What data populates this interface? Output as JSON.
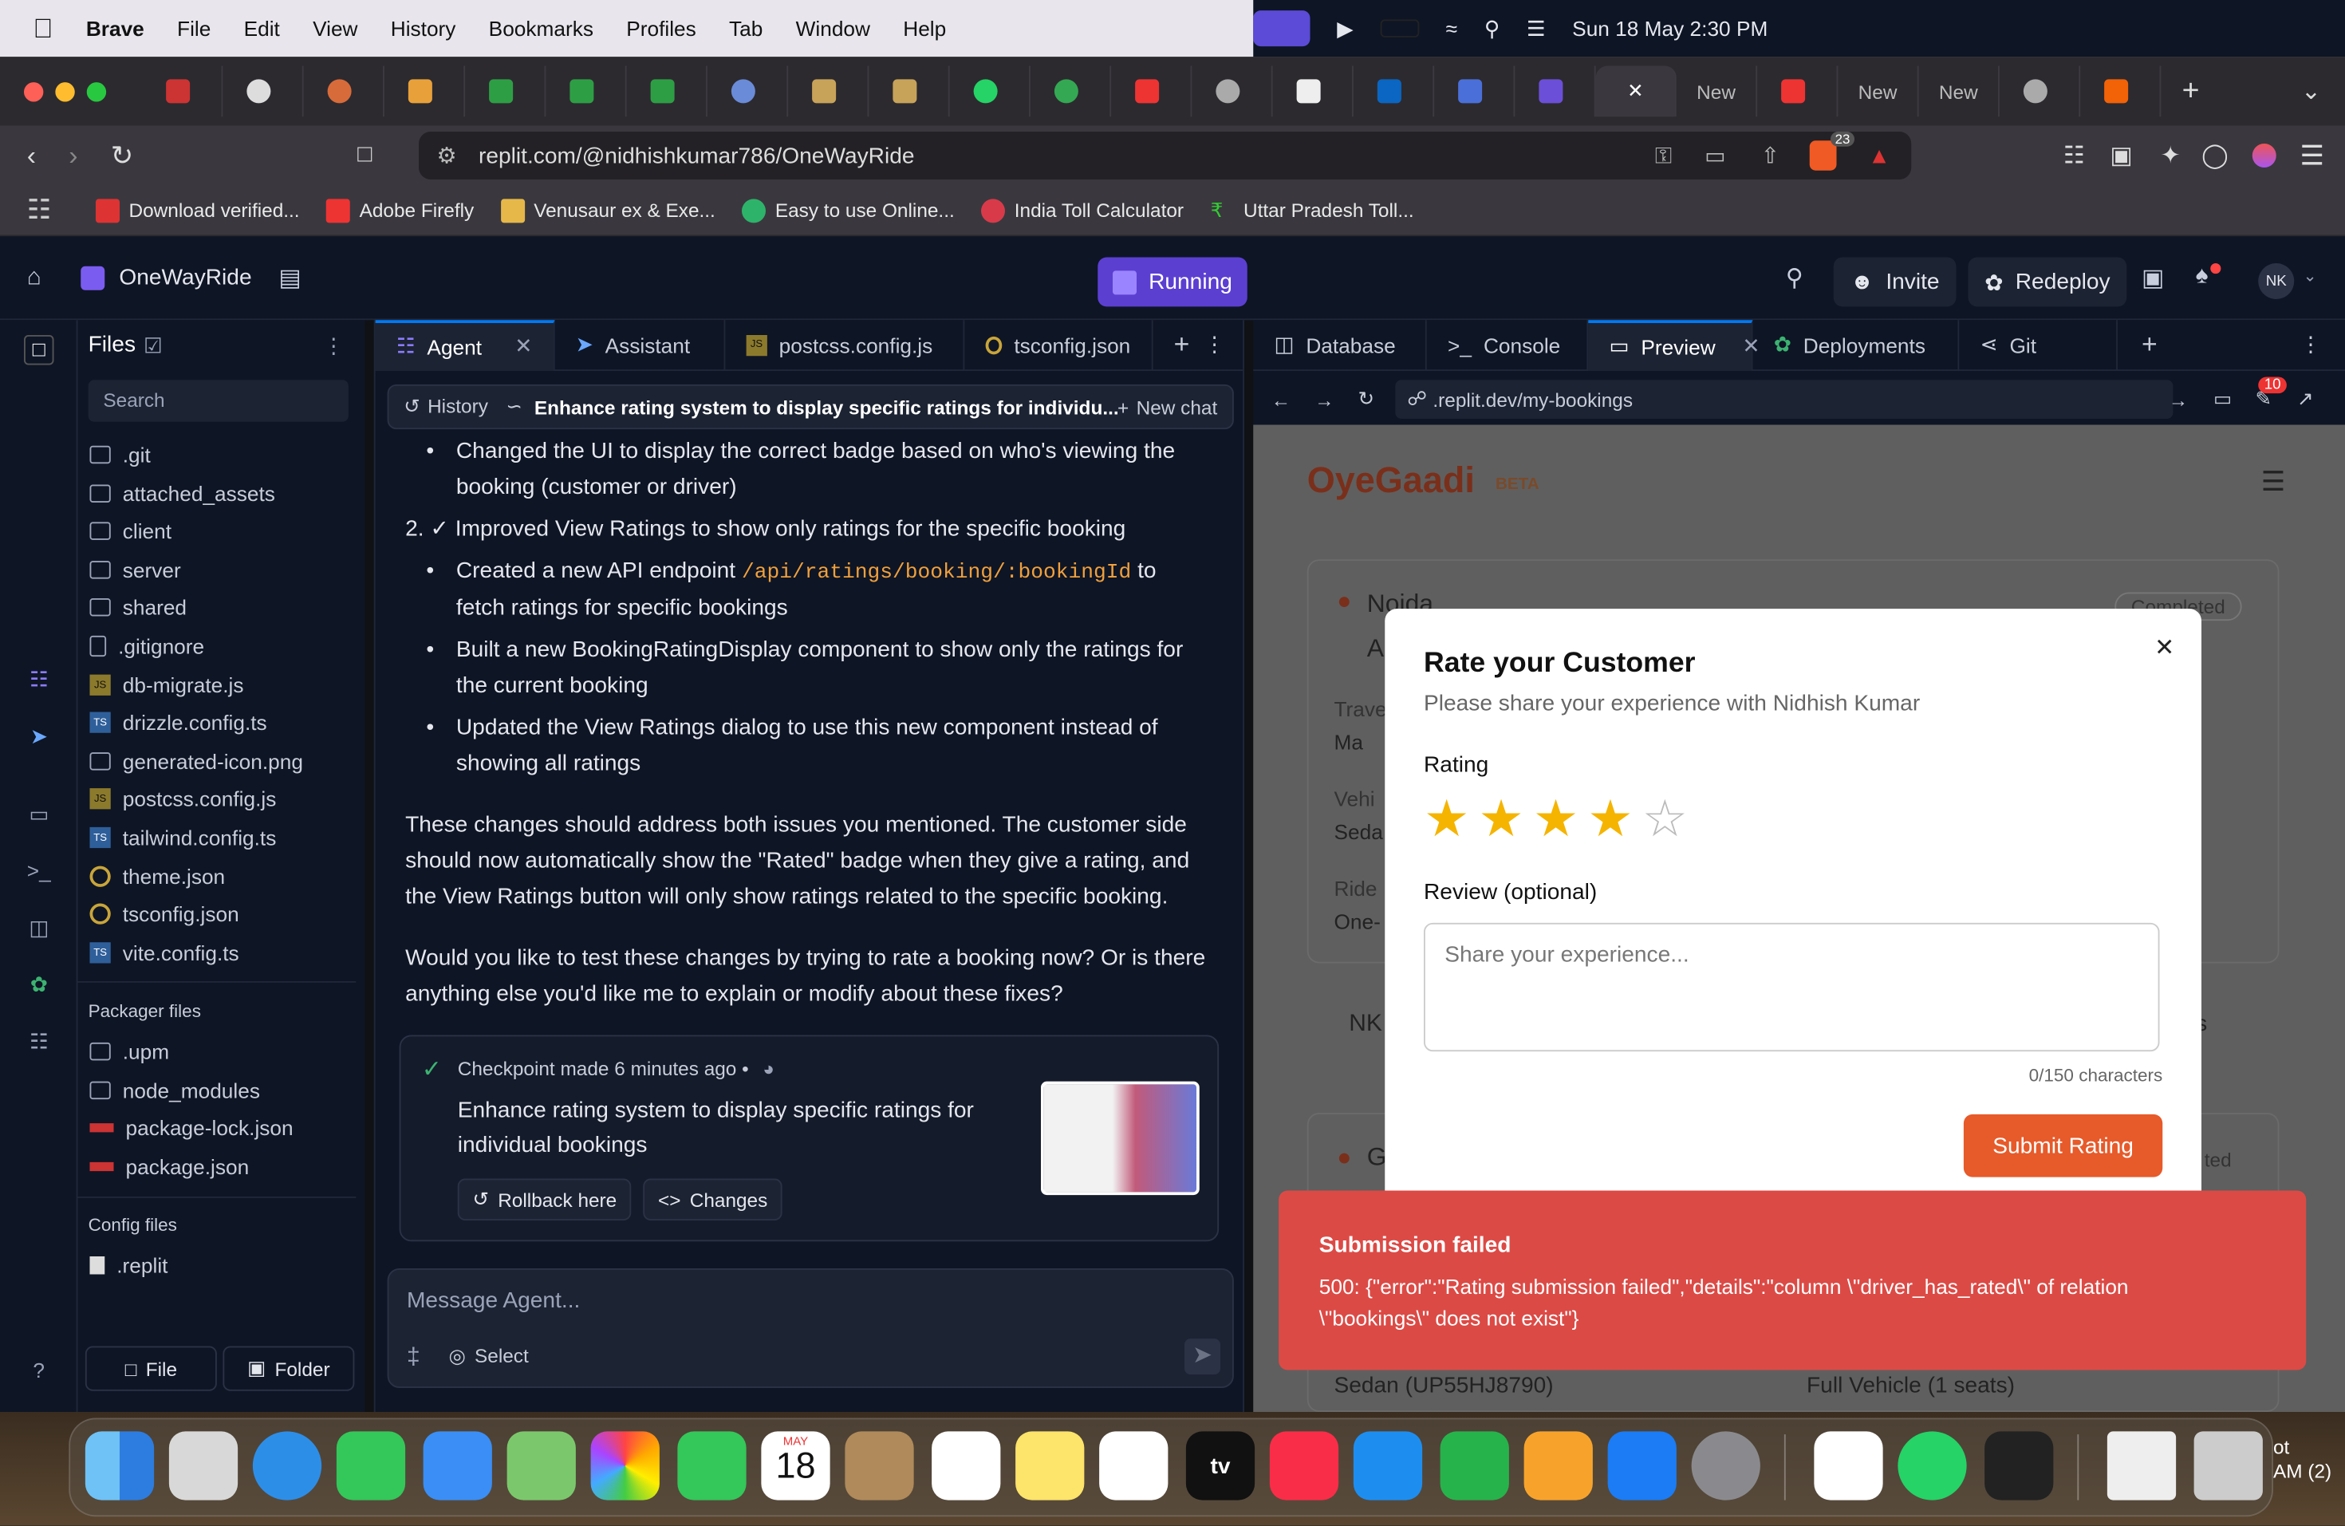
{
  "menubar": {
    "apple": "",
    "app": "Brave",
    "items": [
      "File",
      "Edit",
      "View",
      "History",
      "Bookmarks",
      "Profiles",
      "Tab",
      "Window",
      "Help"
    ],
    "datetime": "Sun 18 May  2:30 PM"
  },
  "tabs": {
    "labels": [
      "New",
      "New",
      "New"
    ]
  },
  "toolbar": {
    "url": "replit.com/@nidhishkumar786/OneWayRide",
    "brave_badge": "23"
  },
  "bookmarks": [
    "Download verified...",
    "Adobe Firefly",
    "Venusaur ex & Exe...",
    "Easy to use Online...",
    "India Toll Calculator",
    "Uttar Pradesh Toll..."
  ],
  "replit": {
    "project": "OneWayRide",
    "status": "Running",
    "invite": "Invite",
    "redeploy": "Redeploy",
    "avatar": "NK"
  },
  "files": {
    "title": "Files",
    "search": "Search",
    "items": [
      ".git",
      "attached_assets",
      "client",
      "server",
      "shared",
      ".gitignore",
      "db-migrate.js",
      "drizzle.config.ts",
      "generated-icon.png",
      "postcss.config.js",
      "tailwind.config.ts",
      "theme.json",
      "tsconfig.json",
      "vite.config.ts"
    ],
    "packager_title": "Packager files",
    "packager": [
      ".upm",
      "node_modules",
      "package-lock.json",
      "package.json"
    ],
    "config_title": "Config files",
    "config": [
      ".replit"
    ],
    "file_btn": "File",
    "folder_btn": "Folder"
  },
  "agent": {
    "tabs": [
      "Agent",
      "Assistant",
      "postcss.config.js",
      "tsconfig.json"
    ],
    "history": "History",
    "thread": "Enhance rating system to display specific ratings for individu...",
    "new_chat": "New chat",
    "line1": "Changed the UI to display the correct badge based on who's viewing the",
    "line1b": "booking (customer or driver)",
    "item2": "2. ✓ Improved View Ratings to show only ratings for the specific booking",
    "b1a": "Created a new API endpoint ",
    "b1code": "/api/ratings/booking/:bookingId",
    "b1b": " to",
    "b1c": "fetch ratings for specific bookings",
    "b2a": "Built a new BookingRatingDisplay component to show only the ratings for",
    "b2b": "the current booking",
    "b3a": "Updated the View Ratings dialog to use this new component instead of",
    "b3b": "showing all ratings",
    "p1a": "These changes should address both issues you mentioned. The customer side",
    "p1b": "should now automatically show the \"Rated\" badge when they give a rating, and",
    "p1c": "the View Ratings button will only show ratings related to the specific booking.",
    "p2a": "Would you like to test these changes by trying to rate a booking now? Or is there",
    "p2b": "anything else you'd like me to explain or modify about these fixes?",
    "checkpoint": "Checkpoint made",
    "checkpoint_time": "6 minutes ago",
    "cp_title_a": "Enhance rating system to display specific ratings for",
    "cp_title_b": "individual bookings",
    "rollback": "Rollback here",
    "changes": "Changes",
    "input_placeholder": "Message Agent...",
    "select": "Select"
  },
  "preview": {
    "tabs": [
      "Database",
      "Console",
      "Preview",
      "Deployments",
      "Git"
    ],
    "url": ".replit.dev/my-bookings",
    "badge": "10",
    "brand": "OyeGaadi",
    "brand_tag": "BETA",
    "bg_city1": "Noida",
    "bg_a": "A",
    "bg_trav": "Trave",
    "bg_ma": "Ma",
    "bg_vehi": "Vehi",
    "bg_seda": "Seda",
    "bg_ride": "Ride",
    "bg_one": "One-",
    "bg_nk": "NK",
    "bg_gs": "gs",
    "bg_g": "G",
    "bg_completed": "Completed",
    "bg_ted": "ted",
    "bg_sedan": "Sedan (UP55HJ8790)",
    "bg_full": "Full Vehicle (1 seats)",
    "dialog": {
      "title": "Rate your Customer",
      "subtitle": "Please share your experience with Nidhish Kumar",
      "rating_label": "Rating",
      "rating_value": 4,
      "rating_max": 5,
      "review_label": "Review (optional)",
      "review_placeholder": "Share your experience...",
      "counter": "0/150 characters",
      "submit": "Submit Rating"
    },
    "toast": {
      "title": "Submission failed",
      "line1": "500: {\"error\":\"Rating submission failed\",\"details\":\"column \\\"driver_has_rated\\\" of relation",
      "line2": "\\\"bookings\\\" does not exist\"}"
    }
  },
  "dock": {
    "date_month": "MAY",
    "date_day": "18",
    "tv": "tv",
    "edge_text_a": "ot",
    "edge_text_b": "AM (2)"
  }
}
